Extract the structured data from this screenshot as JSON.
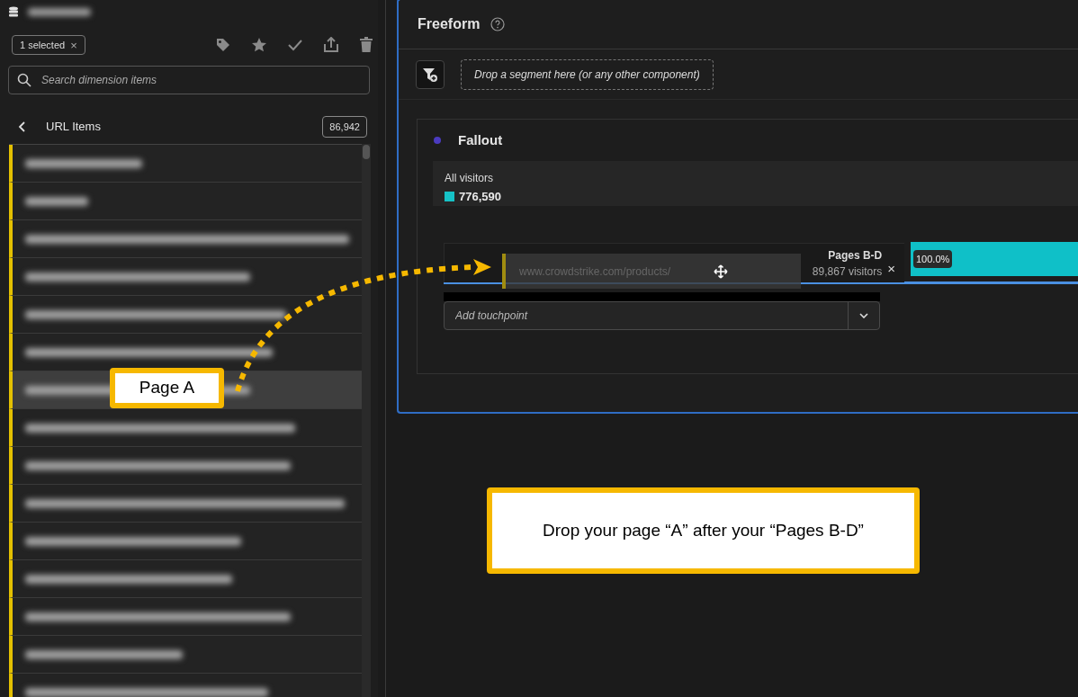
{
  "panel": {
    "selection_chip": {
      "label": "1 selected",
      "close": "×"
    },
    "search": {
      "placeholder": "Search dimension items"
    },
    "list_header": {
      "title": "URL Items",
      "count": "86,942"
    },
    "items": [
      {
        "selected": false
      },
      {
        "selected": false
      },
      {
        "selected": false
      },
      {
        "selected": false
      },
      {
        "selected": false
      },
      {
        "selected": false
      },
      {
        "selected": true
      },
      {
        "selected": false
      },
      {
        "selected": false
      },
      {
        "selected": false
      },
      {
        "selected": false
      },
      {
        "selected": false
      },
      {
        "selected": false
      },
      {
        "selected": false
      },
      {
        "selected": false
      }
    ]
  },
  "freeform": {
    "title": "Freeform",
    "segment_drop": {
      "placeholder": "Drop a segment here (or any other component)"
    },
    "fallout": {
      "title": "Fallout",
      "color": "#4b3bbf",
      "all_visitors": {
        "label": "All visitors",
        "value": "776,590"
      },
      "touchpoint": {
        "title": "Pages B-D",
        "visitors": "89,867 visitors",
        "remove": "×",
        "percent": "100.0%"
      },
      "drag_item": {
        "label": "www.crowdstrike.com/products/"
      },
      "add_touchpoint": {
        "placeholder": "Add touchpoint"
      }
    }
  },
  "annotations": [
    {
      "text": "Page A"
    },
    {
      "text": "Drop your page “A” after your “Pages B-D”"
    }
  ]
}
